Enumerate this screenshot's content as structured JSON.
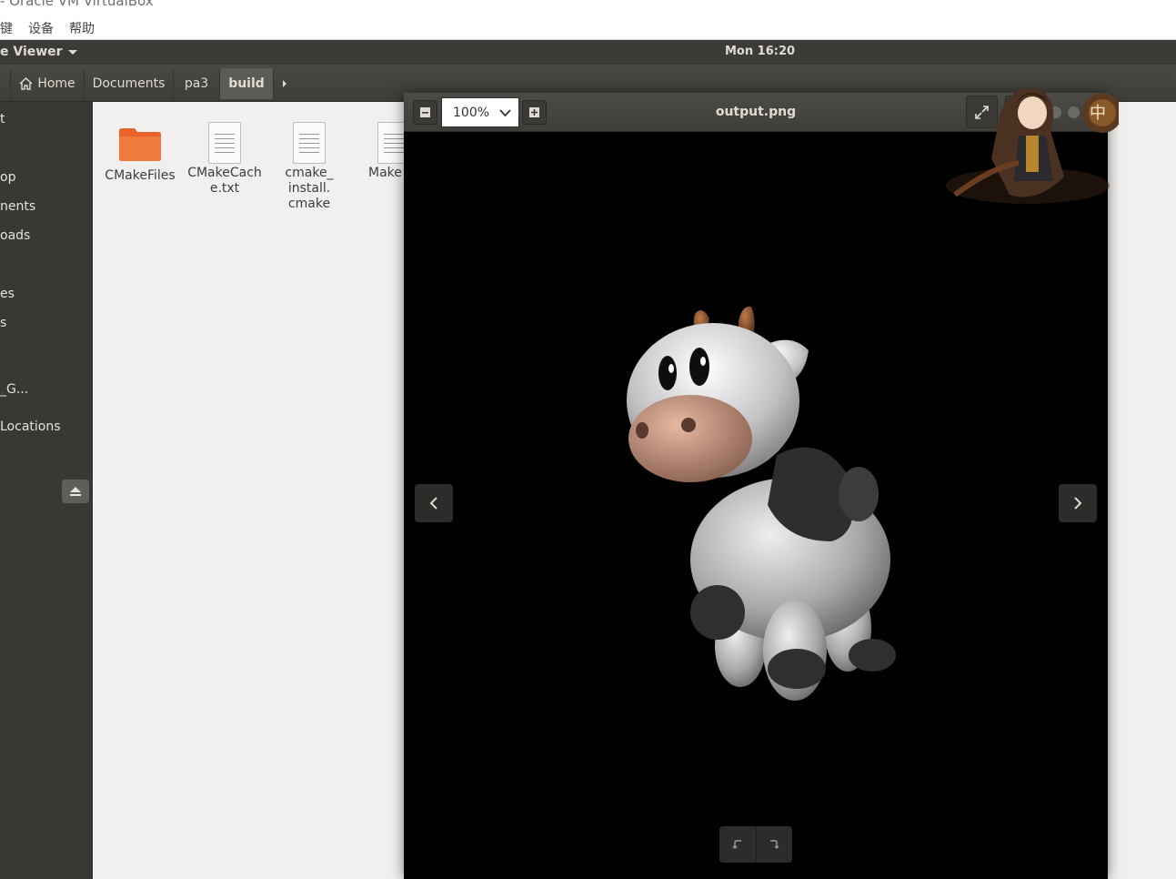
{
  "window_title": "- Oracle VM VirtualBox",
  "vbox_menu": [
    "键",
    "设备",
    "帮助"
  ],
  "topbar": {
    "app_menu": "e Viewer",
    "clock": "Mon 16:20"
  },
  "breadcrumb": [
    "Home",
    "Documents",
    "pa3",
    "build"
  ],
  "sidebar": {
    "items": [
      "t",
      "op",
      "nents",
      "oads",
      "es",
      "s",
      "_G...",
      "Locations"
    ]
  },
  "files": [
    {
      "name": "CMakeFiles",
      "type": "folder"
    },
    {
      "name": "CMakeCache.txt",
      "lines": [
        "CMakeCach",
        "e.txt"
      ],
      "type": "document"
    },
    {
      "name": "cmake_install.cmake",
      "lines": [
        "cmake_",
        "install.",
        "cmake"
      ],
      "type": "document"
    },
    {
      "name": "Make",
      "lines": [
        "Make"
      ],
      "type": "document"
    }
  ],
  "viewer": {
    "zoom": "100%",
    "filename": "output.png",
    "image_subject": "3D rendered cartoon cow on black background"
  },
  "colors": {
    "topbar": "#3c3b37",
    "sidebar": "#393834",
    "content": "#f1f0ee",
    "folder": "#e8622a"
  }
}
